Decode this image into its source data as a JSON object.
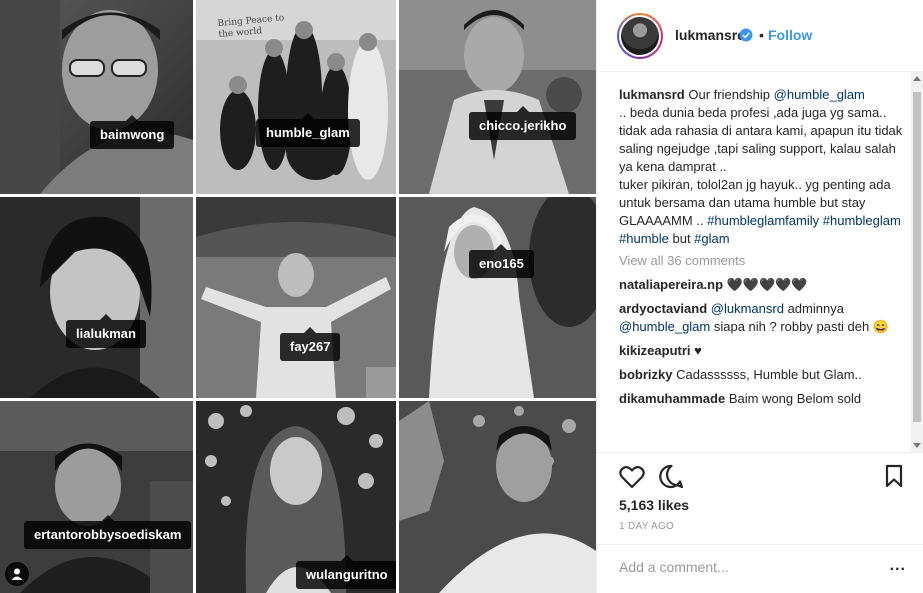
{
  "grid": {
    "tiles": [
      {
        "tag": "baimwong"
      },
      {
        "tag": "humble_glam"
      },
      {
        "tag": "chicco.jerikho"
      },
      {
        "tag": "lialukman"
      },
      {
        "tag": "fay267"
      },
      {
        "tag": "eno165"
      },
      {
        "tag": "ertantorobbysoediskam"
      },
      {
        "tag": ""
      },
      {
        "tag": "wulanguritno"
      }
    ],
    "photo_sign_text": "Bring Peace to the world"
  },
  "header": {
    "username": "lukmansrd",
    "separator": "•",
    "follow_label": "Follow",
    "verified_icon": "verified-badge-icon",
    "accent": "#3897f0"
  },
  "caption": {
    "username": "lukmansrd",
    "text_1": "Our friendship ",
    "mention_1": "@humble_glam",
    "text_2": ".. beda dunia beda profesi ,ada juga yg sama..",
    "text_3": "tidak ada rahasia di antara kami, apapun itu tidak saling ngejudge ,tapi saling support, kalau salah ya kena damprat ..",
    "text_4": "tuker pikiran, tolol2an jg hayuk.. yg penting ada untuk bersama dan utama humble but stay GLAAAAMM .. ",
    "hashtag_1": "#humbleglamfamily",
    "hashtag_2": "#humbleglam",
    "hashtag_3": "#humble",
    "word_but": " but ",
    "hashtag_4": "#glam"
  },
  "view_all": "View all 36 comments",
  "comments": [
    {
      "user": "nataliapereira.np",
      "text": "🖤🖤🖤🖤🖤"
    },
    {
      "user": "ardyoctaviand",
      "mention_a": "@lukmansrd",
      "text_a": " adminnya ",
      "mention_b": "@humble_glam",
      "text_b": " siapa nih ? robby pasti deh 😄"
    },
    {
      "user": "kikizeaputri",
      "text": "♥"
    },
    {
      "user": "bobrizky",
      "text": "Cadassssss, Humble but Glam.."
    },
    {
      "user": "dikamuhammade",
      "text": "Baim wong Belom sold"
    }
  ],
  "actions": {
    "like_icon": "heart-icon",
    "comment_icon": "comment-icon",
    "save_icon": "bookmark-icon",
    "likes": "5,163 likes",
    "time_ago": "1 DAY AGO"
  },
  "add_comment": {
    "placeholder": "Add a comment...",
    "more_label": "..."
  }
}
